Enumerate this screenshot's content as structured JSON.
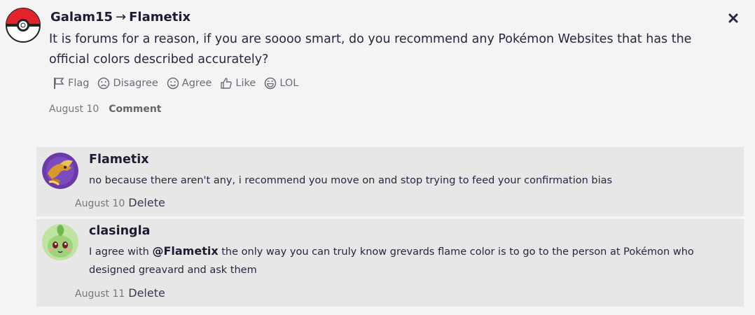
{
  "post": {
    "author": "Galam15",
    "arrow": "→",
    "recipient": "Flametix",
    "body": "It is forums for a reason, if you are soooo smart, do you recommend any Pokémon Websites that has the official colors described accurately?",
    "reactions": [
      {
        "label": "Flag",
        "icon": "flag-icon"
      },
      {
        "label": "Disagree",
        "icon": "sad-face-icon"
      },
      {
        "label": "Agree",
        "icon": "smile-face-icon"
      },
      {
        "label": "Like",
        "icon": "thumbs-up-icon"
      },
      {
        "label": "LOL",
        "icon": "laugh-face-icon"
      }
    ],
    "date": "August 10",
    "comment_label": "Comment",
    "close_icon": "close-icon"
  },
  "comments": [
    {
      "author": "Flametix",
      "text": "no because there aren't any, i recommend you move on and stop trying to feed your confirmation bias",
      "date": "August 10",
      "delete_label": "Delete"
    },
    {
      "author": "clasingla",
      "text_before": "I agree with ",
      "mention": "@Flametix",
      "text_after": " the only way you can truly know grevards flame color is to go to the person at Pokémon who designed greavard and ask them",
      "date": "August 11",
      "delete_label": "Delete"
    }
  ],
  "colors": {
    "background": "#f4f4f4",
    "comment_background": "#e7e7e7",
    "text": "#1f1b33",
    "muted": "#777777"
  }
}
